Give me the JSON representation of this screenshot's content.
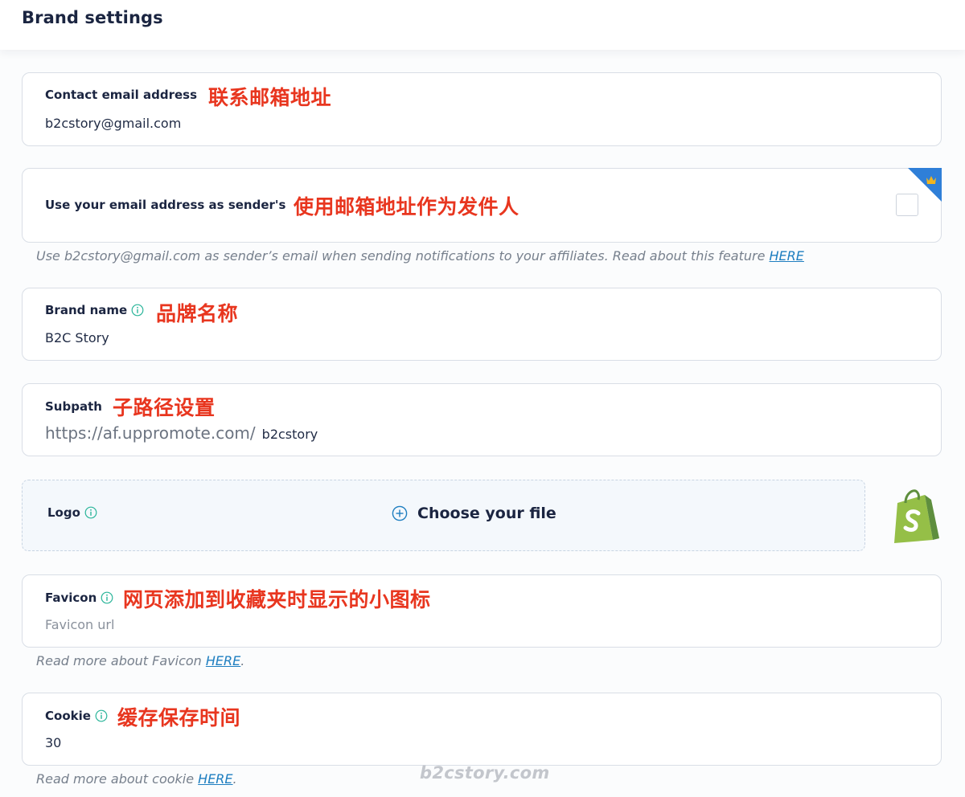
{
  "header": {
    "title": "Brand settings"
  },
  "contact_email": {
    "label": "Contact email address",
    "annotation": "联系邮箱地址",
    "value": "b2cstory@gmail.com"
  },
  "sender_email": {
    "label": "Use your email address as sender's",
    "annotation": "使用邮箱地址作为发件人",
    "checked": false,
    "hint": "Use b2cstory@gmail.com as sender’s email when sending notifications to your affiliates. Read about this feature ",
    "hint_link": "HERE"
  },
  "brand_name": {
    "label": "Brand name",
    "annotation": "品牌名称",
    "value": "B2C Story"
  },
  "subpath": {
    "label": "Subpath",
    "annotation": "子路径设置",
    "prefix": "https://af.uppromote.com/",
    "value": "b2cstory"
  },
  "logo": {
    "label": "Logo",
    "choose_label": "Choose your file"
  },
  "favicon": {
    "label": "Favicon",
    "annotation": "网页添加到收藏夹时显示的小图标",
    "placeholder": "Favicon url",
    "hint": "Read more about Favicon ",
    "hint_link": "HERE",
    "hint_suffix": "."
  },
  "cookie": {
    "label": "Cookie",
    "annotation": "缓存保存时间",
    "value": "30",
    "hint": "Read more about cookie ",
    "hint_link": "HERE",
    "hint_suffix": "."
  },
  "watermark": "b2cstory.com",
  "colors": {
    "annotation": "#e8361f",
    "accent": "#1e7ec0",
    "info_icon": "#2bb59a",
    "ribbon": "#2f7fd8",
    "crown": "#f2b51d",
    "shopify_green": "#95bf47"
  },
  "icons": [
    "info-icon",
    "crown-icon",
    "plus-circle-icon",
    "shopify-icon"
  ]
}
